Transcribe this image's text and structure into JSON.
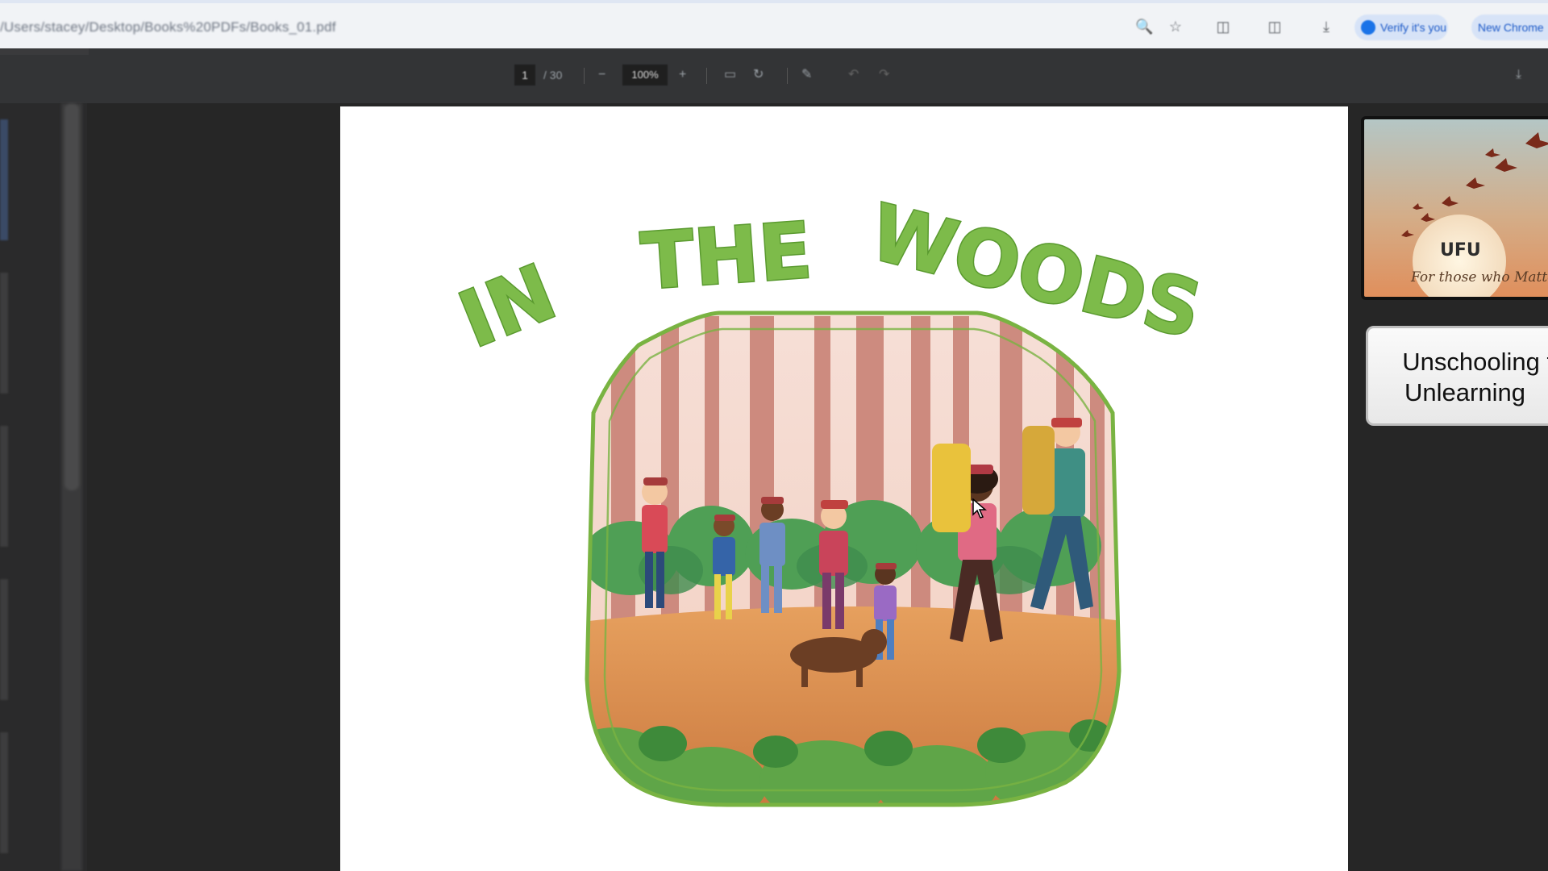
{
  "browser": {
    "url": "/Users/stacey/Desktop/Books%20PDFs/Books_01.pdf",
    "profile_label": "Verify it's you",
    "action_label": "New Chrome"
  },
  "pdf_toolbar": {
    "page_current": "1",
    "page_total": "/ 30",
    "zoom": "100%"
  },
  "page": {
    "title_words": [
      "IN",
      "THE",
      "WOODS"
    ]
  },
  "right_panel": {
    "ufu_card": {
      "brand": "UFU",
      "tagline": "For those who Matter"
    },
    "unschool_card": {
      "line1": "Unschooling for",
      "line2": "Unlearning"
    }
  },
  "colors": {
    "title_green": "#7dbb4a",
    "frame_green": "#79b342",
    "toolbar_bg": "#333436",
    "page_bg": "#ffffff"
  }
}
